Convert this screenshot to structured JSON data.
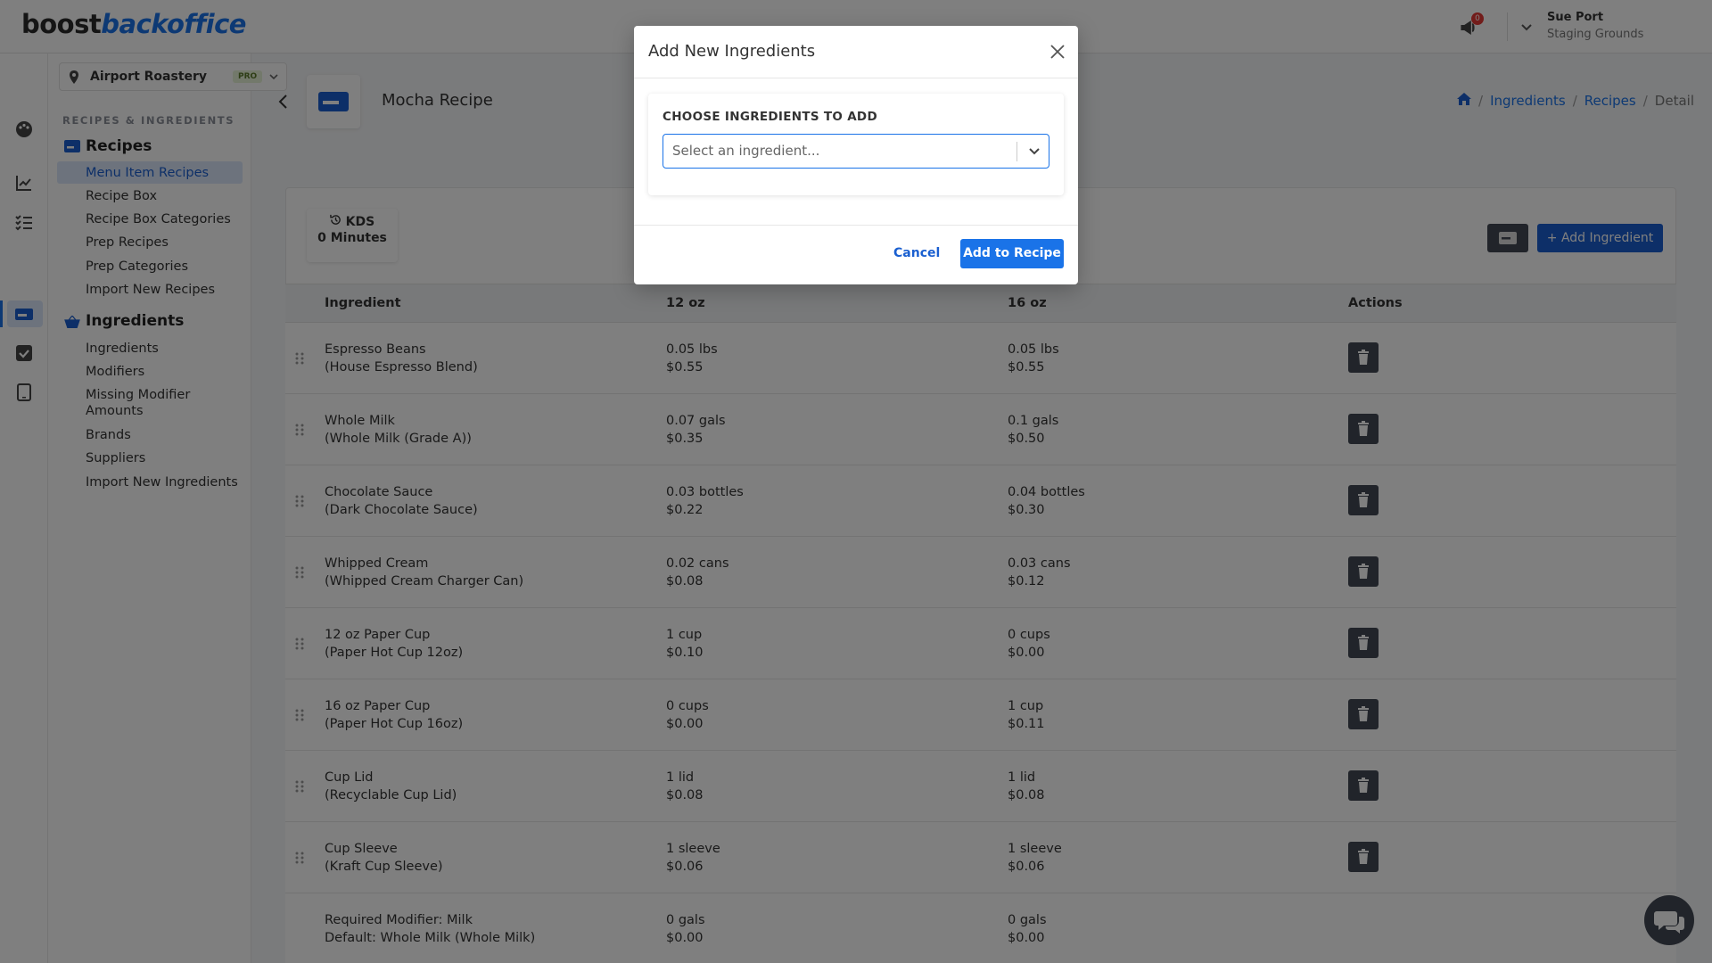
{
  "header": {
    "logo_part1": "boost",
    "logo_part2": "backoffice",
    "notification_count": "0",
    "user_name": "Sue Port",
    "user_org": "Staging Grounds"
  },
  "sidebar": {
    "location": "Airport Roastery",
    "plan_badge": "PRO",
    "section_header": "RECIPES & INGREDIENTS",
    "recipes_group": "Recipes",
    "recipe_items": [
      "Menu Item Recipes",
      "Recipe Box",
      "Recipe Box Categories",
      "Prep Recipes",
      "Prep Categories",
      "Import New Recipes"
    ],
    "ingredients_group": "Ingredients",
    "ingredient_items": [
      "Ingredients",
      "Modifiers",
      "Missing Modifier Amounts",
      "Brands",
      "Suppliers",
      "Import New Ingredients"
    ]
  },
  "page": {
    "title": "Mocha Recipe",
    "breadcrumb": [
      "Ingredients",
      "Recipes",
      "Detail"
    ],
    "kds_label": "KDS",
    "kds_value": "0 Minutes",
    "add_ingredient_button": "Add Ingredient"
  },
  "table": {
    "headers": [
      "Ingredient",
      "12 oz",
      "16 oz",
      "Actions"
    ],
    "rows": [
      {
        "name": "Espresso Beans",
        "sub": "(House Espresso Blend)",
        "a_qty": "0.05 lbs",
        "a_cost": "$0.55",
        "b_qty": "0.05 lbs",
        "b_cost": "$0.55"
      },
      {
        "name": "Whole Milk",
        "sub": "(Whole Milk (Grade A))",
        "a_qty": "0.07 gals",
        "a_cost": "$0.35",
        "b_qty": "0.1 gals",
        "b_cost": "$0.50"
      },
      {
        "name": "Chocolate Sauce",
        "sub": "(Dark Chocolate Sauce)",
        "a_qty": "0.03 bottles",
        "a_cost": "$0.22",
        "b_qty": "0.04 bottles",
        "b_cost": "$0.30"
      },
      {
        "name": "Whipped Cream",
        "sub": "(Whipped Cream Charger Can)",
        "a_qty": "0.02 cans",
        "a_cost": "$0.08",
        "b_qty": "0.03 cans",
        "b_cost": "$0.12"
      },
      {
        "name": "12 oz Paper Cup",
        "sub": "(Paper Hot Cup 12oz)",
        "a_qty": "1 cup",
        "a_cost": "$0.10",
        "b_qty": "0 cups",
        "b_cost": "$0.00"
      },
      {
        "name": "16 oz Paper Cup",
        "sub": "(Paper Hot Cup 16oz)",
        "a_qty": "0 cups",
        "a_cost": "$0.00",
        "b_qty": "1 cup",
        "b_cost": "$0.11"
      },
      {
        "name": "Cup Lid",
        "sub": "(Recyclable Cup Lid)",
        "a_qty": "1 lid",
        "a_cost": "$0.08",
        "b_qty": "1 lid",
        "b_cost": "$0.08"
      },
      {
        "name": "Cup Sleeve",
        "sub": "(Kraft Cup Sleeve)",
        "a_qty": "1 sleeve",
        "a_cost": "$0.06",
        "b_qty": "1 sleeve",
        "b_cost": "$0.06"
      },
      {
        "name": "Required Modifier: Milk",
        "sub": "Default: Whole Milk (Whole Milk)",
        "a_qty": "0 gals",
        "a_cost": "$0.00",
        "b_qty": "0 gals",
        "b_cost": "$0.00"
      }
    ]
  },
  "modal": {
    "title": "Add New Ingredients",
    "label": "CHOOSE INGREDIENTS TO ADD",
    "placeholder": "Select an ingredient...",
    "cancel": "Cancel",
    "submit": "Add to Recipe"
  },
  "colors": {
    "accent": "#1a73e8",
    "dark_button": "#424954",
    "overlay": "#000000"
  }
}
